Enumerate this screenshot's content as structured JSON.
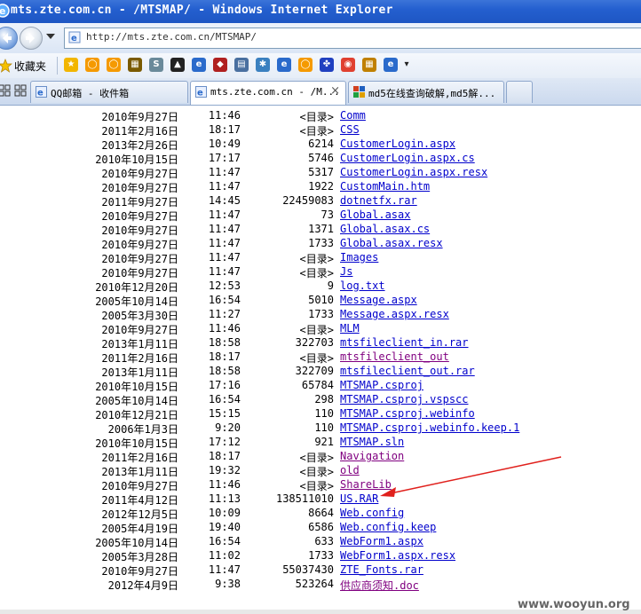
{
  "window": {
    "title": "mts.zte.com.cn - /MTSMAP/ - Windows Internet Explorer"
  },
  "address": {
    "url": "http://mts.zte.com.cn/MTSMAP/"
  },
  "favorites": {
    "label": "收藏夹"
  },
  "tabs": [
    {
      "label": "QQ邮箱 - 收件箱"
    },
    {
      "label": "mts.zte.com.cn - /M...",
      "close": "×"
    },
    {
      "label": "md5在线查询破解,md5解..."
    }
  ],
  "listing": [
    {
      "date": "2010年9月27日",
      "time": "11:46",
      "size": "<目录>",
      "name": "Comm"
    },
    {
      "date": "2011年2月16日",
      "time": "18:17",
      "size": "<目录>",
      "name": "CSS"
    },
    {
      "date": "2013年2月26日",
      "time": "10:49",
      "size": "6214",
      "name": "CustomerLogin.aspx"
    },
    {
      "date": "2010年10月15日",
      "time": "17:17",
      "size": "5746",
      "name": "CustomerLogin.aspx.cs"
    },
    {
      "date": "2010年9月27日",
      "time": "11:47",
      "size": "5317",
      "name": "CustomerLogin.aspx.resx"
    },
    {
      "date": "2010年9月27日",
      "time": "11:47",
      "size": "1922",
      "name": "CustomMain.htm"
    },
    {
      "date": "2011年9月27日",
      "time": "14:45",
      "size": "22459083",
      "name": "dotnetfx.rar"
    },
    {
      "date": "2010年9月27日",
      "time": "11:47",
      "size": "73",
      "name": "Global.asax"
    },
    {
      "date": "2010年9月27日",
      "time": "11:47",
      "size": "1371",
      "name": "Global.asax.cs"
    },
    {
      "date": "2010年9月27日",
      "time": "11:47",
      "size": "1733",
      "name": "Global.asax.resx"
    },
    {
      "date": "2010年9月27日",
      "time": "11:47",
      "size": "<目录>",
      "name": "Images"
    },
    {
      "date": "2010年9月27日",
      "time": "11:47",
      "size": "<目录>",
      "name": "Js"
    },
    {
      "date": "2010年12月20日",
      "time": "12:53",
      "size": "9",
      "name": "log.txt"
    },
    {
      "date": "2005年10月14日",
      "time": "16:54",
      "size": "5010",
      "name": "Message.aspx"
    },
    {
      "date": "2005年3月30日",
      "time": "11:27",
      "size": "1733",
      "name": "Message.aspx.resx"
    },
    {
      "date": "2010年9月27日",
      "time": "11:46",
      "size": "<目录>",
      "name": "MLM"
    },
    {
      "date": "2013年1月11日",
      "time": "18:58",
      "size": "322703",
      "name": "mtsfileclient_in.rar"
    },
    {
      "date": "2011年2月16日",
      "time": "18:17",
      "size": "<目录>",
      "name": "mtsfileclient_out"
    },
    {
      "date": "2013年1月11日",
      "time": "18:58",
      "size": "322709",
      "name": "mtsfileclient_out.rar"
    },
    {
      "date": "2010年10月15日",
      "time": "17:16",
      "size": "65784",
      "name": "MTSMAP.csproj"
    },
    {
      "date": "2005年10月14日",
      "time": "16:54",
      "size": "298",
      "name": "MTSMAP.csproj.vspscc"
    },
    {
      "date": "2010年12月21日",
      "time": "15:15",
      "size": "110",
      "name": "MTSMAP.csproj.webinfo"
    },
    {
      "date": "2006年1月3日",
      "time": "9:20",
      "size": "110",
      "name": "MTSMAP.csproj.webinfo.keep.1"
    },
    {
      "date": "2010年10月15日",
      "time": "17:12",
      "size": "921",
      "name": "MTSMAP.sln"
    },
    {
      "date": "2011年2月16日",
      "time": "18:17",
      "size": "<目录>",
      "name": "Navigation"
    },
    {
      "date": "2013年1月11日",
      "time": "19:32",
      "size": "<目录>",
      "name": "old"
    },
    {
      "date": "2010年9月27日",
      "time": "11:46",
      "size": "<目录>",
      "name": "ShareLib"
    },
    {
      "date": "2011年4月12日",
      "time": "11:13",
      "size": "138511010",
      "name": "US.RAR"
    },
    {
      "date": "2012年12月5日",
      "time": "10:09",
      "size": "8664",
      "name": "Web.config"
    },
    {
      "date": "2005年4月19日",
      "time": "19:40",
      "size": "6586",
      "name": "Web.config.keep"
    },
    {
      "date": "2005年10月14日",
      "time": "16:54",
      "size": "633",
      "name": "WebForm1.aspx"
    },
    {
      "date": "2005年3月28日",
      "time": "11:02",
      "size": "1733",
      "name": "WebForm1.aspx.resx"
    },
    {
      "date": "2010年9月27日",
      "time": "11:47",
      "size": "55037430",
      "name": "ZTE_Fonts.rar"
    },
    {
      "date": "2012年4月9日",
      "time": "9:38",
      "size": "523264",
      "name": "供应商须知.doc"
    }
  ],
  "watermark": "www.wooyun.org",
  "colors": {
    "link": "#0000cc",
    "visited": "#800080",
    "annotation": "#e0201c",
    "titlebar": "#245fcf"
  }
}
